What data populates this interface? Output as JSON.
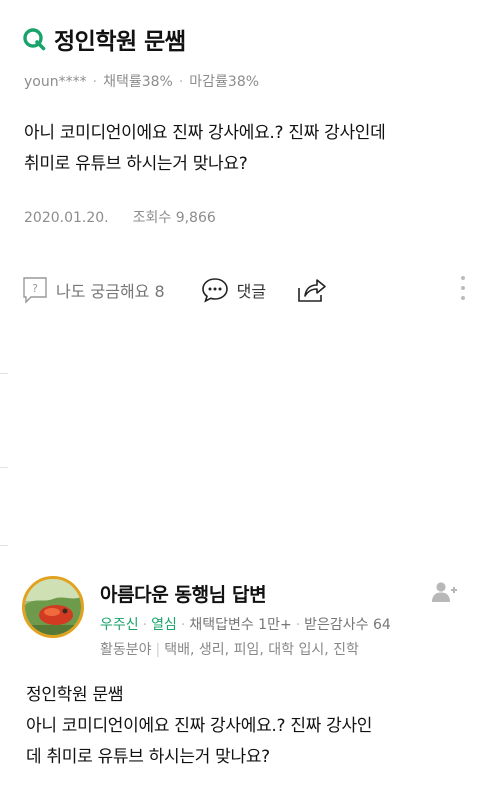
{
  "question": {
    "q_mark_icon": "q-logo-icon",
    "title": "정인학원 문쌤",
    "author": "youn****",
    "adopt_rate": "채택률38%",
    "close_rate": "마감률38%",
    "body_line1": "아니 코미디언이에요 진짜 강사에요.? 진짜 강사인데",
    "body_line2": "취미로 유튜브 하시는거 맞나요?",
    "date": "2020.01.20.",
    "views": "조회수 9,866"
  },
  "actions": {
    "curious_label": "나도 궁금해요 8",
    "comment_label": "댓글",
    "curious_icon": "question-box-icon",
    "comment_icon": "speech-bubble-icon",
    "share_icon": "share-icon",
    "more_icon": "more-vertical-icon"
  },
  "answer": {
    "name": "아름다운 동행님 답변",
    "badge1": "우주신",
    "badge2": "열심",
    "adopted": "채택답변수 1만+",
    "thanks": "받은감사수 64",
    "field_label": "활동분야",
    "fields": "택배, 생리, 피임, 대학 입시, 진학",
    "body_line1": "정인학원 문쌤",
    "body_line2": "아니 코미디언이에요 진짜 강사에요.? 진짜 강사인",
    "body_line3": "데 취미로 유튜브 하시는거 맞나요?",
    "follow_icon": "add-user-icon",
    "avatar_icon": "avatar"
  },
  "colors": {
    "brand_green": "#19a36a",
    "avatar_ring": "#e2a21f"
  }
}
